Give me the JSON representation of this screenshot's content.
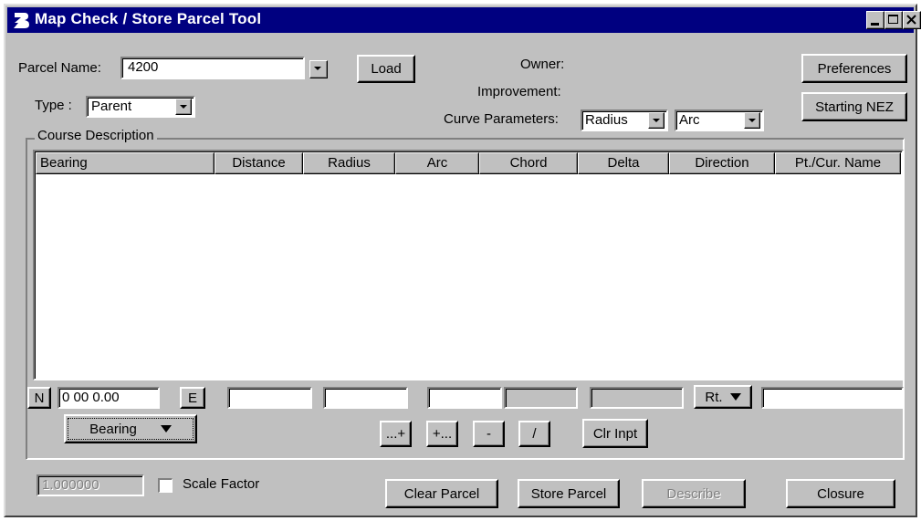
{
  "window": {
    "title": "Map Check / Store Parcel Tool"
  },
  "parcel": {
    "name_label": "Parcel Name:",
    "name_value": "4200",
    "load_label": "Load",
    "type_label": "Type :",
    "type_value": "Parent"
  },
  "info": {
    "owner_label": "Owner:",
    "improvement_label": "Improvement:",
    "curve_params_label": "Curve Parameters:",
    "curve_param_1": "Radius",
    "curve_param_2": "Arc"
  },
  "right_buttons": {
    "preferences": "Preferences",
    "starting_nez": "Starting NEZ"
  },
  "course": {
    "group_label": "Course Description",
    "columns": [
      "Bearing",
      "Distance",
      "Radius",
      "Arc",
      "Chord",
      "Delta",
      "Direction",
      "Pt./Cur. Name"
    ]
  },
  "input_row": {
    "n_label": "N",
    "bearing_value": "0 00 0.00",
    "e_label": "E",
    "direction_value": "Rt.",
    "bearing_type": "Bearing"
  },
  "action_buttons": {
    "insert_after": "...+",
    "insert_before": "+...",
    "delete": "-",
    "slash": "/",
    "clear_input": "Clr Inpt"
  },
  "bottom": {
    "scale_value": "1.000000",
    "scale_label": "Scale Factor",
    "clear_parcel": "Clear Parcel",
    "store_parcel": "Store Parcel",
    "describe": "Describe",
    "closure": "Closure"
  }
}
